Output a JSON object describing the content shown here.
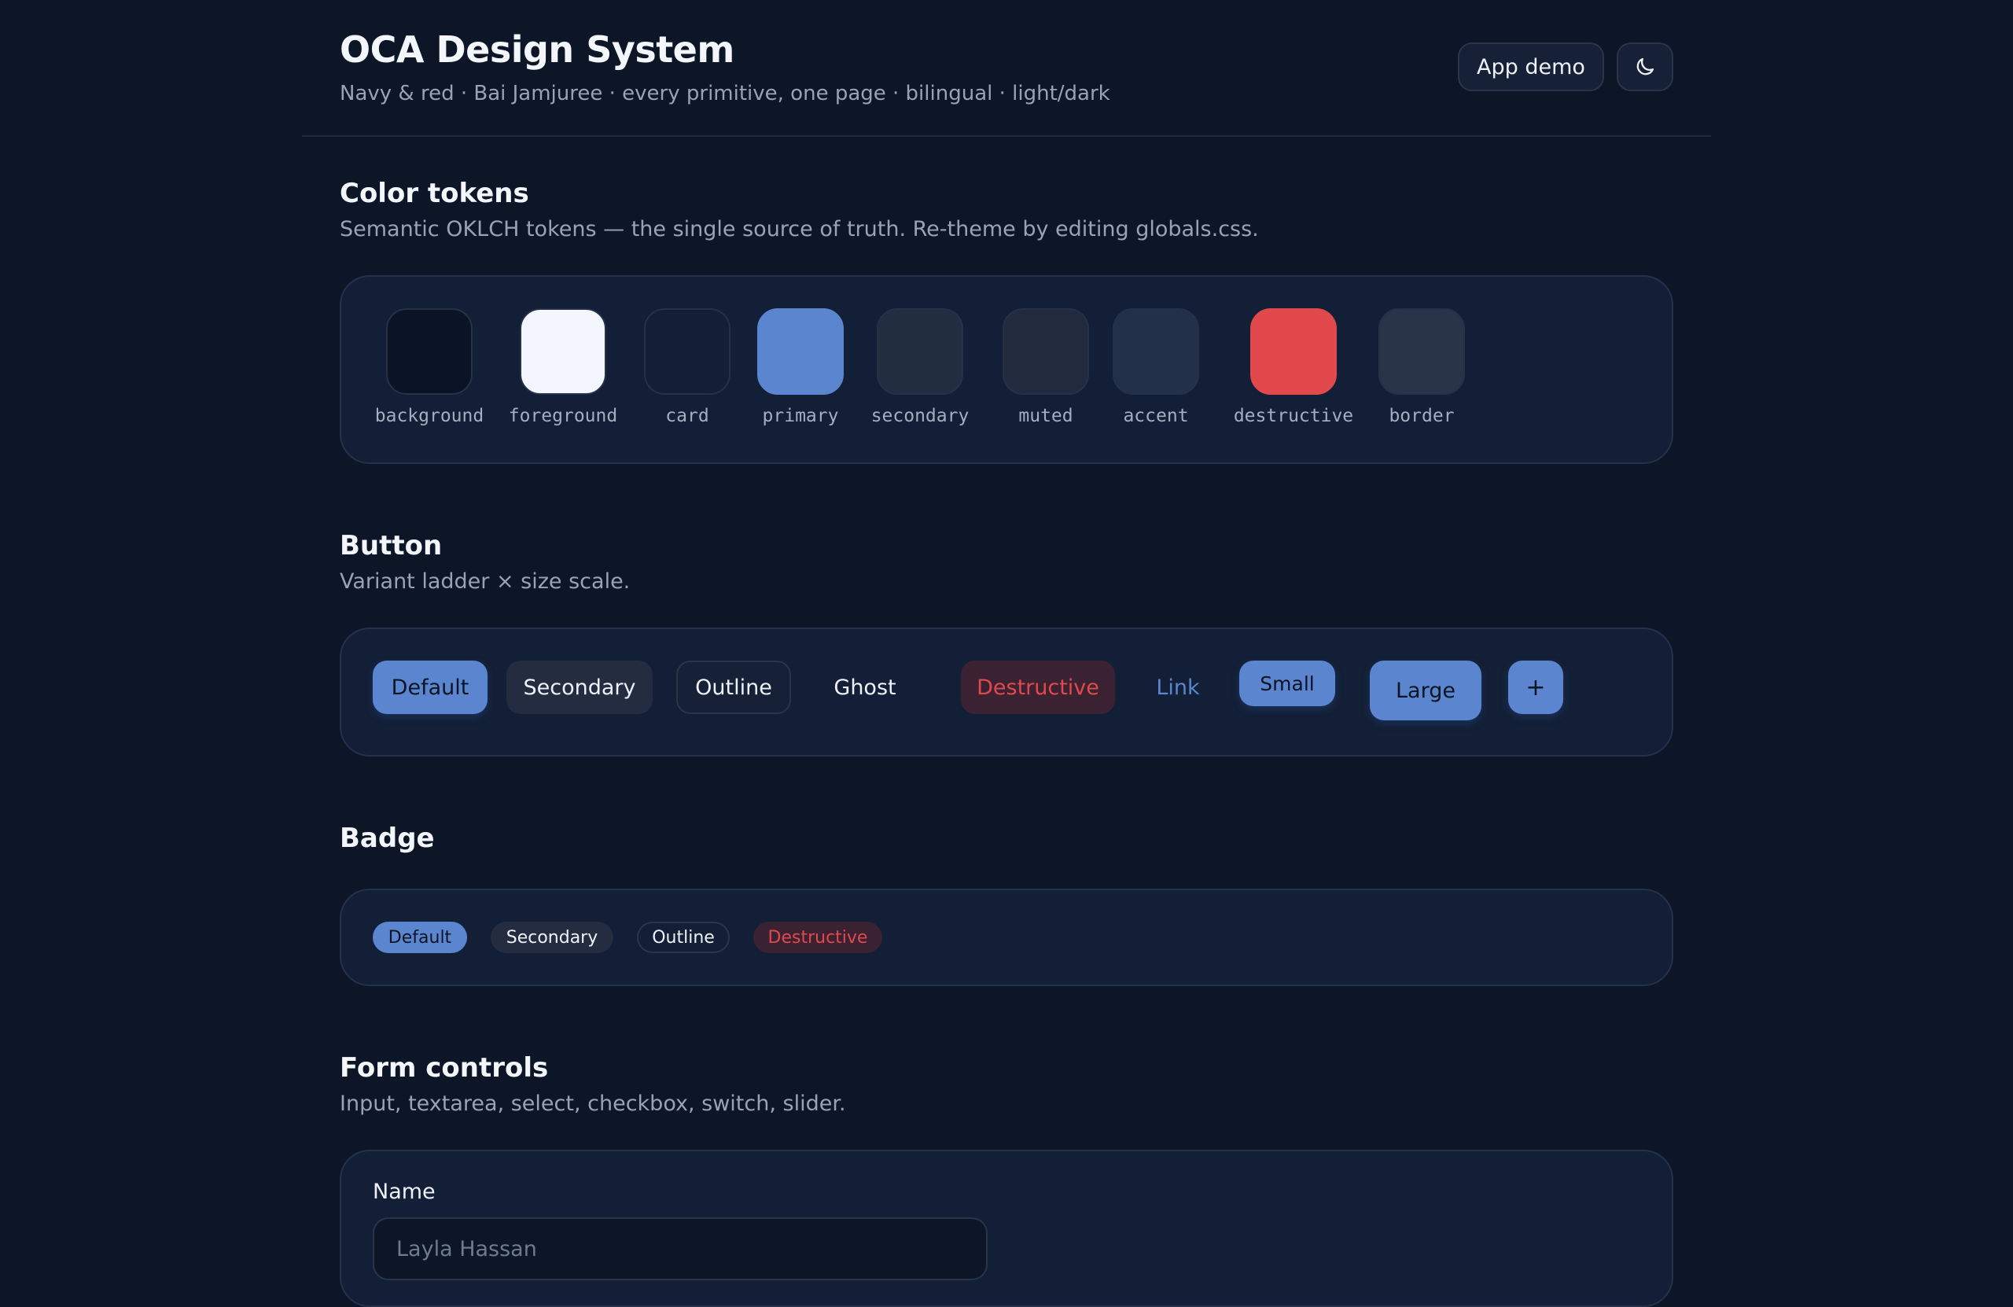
{
  "header": {
    "title": "OCA Design System",
    "subtitle": "Navy & red · Bai Jamjuree · every primitive, one page · bilingual · light/dark",
    "demo_button": "App demo",
    "theme_toggle_icon": "moon-icon"
  },
  "color_tokens": {
    "title": "Color tokens",
    "description": "Semantic OKLCH tokens — the single source of truth. Re-theme by editing globals.css.",
    "tokens": [
      {
        "name": "background",
        "color": "#0b1424"
      },
      {
        "name": "foreground",
        "color": "#f3f6fc"
      },
      {
        "name": "card",
        "color": "#131f36"
      },
      {
        "name": "primary",
        "color": "#5b86cf"
      },
      {
        "name": "secondary",
        "color": "#222d40"
      },
      {
        "name": "muted",
        "color": "#212b3d"
      },
      {
        "name": "accent",
        "color": "#23304a"
      },
      {
        "name": "destructive",
        "color": "#e2494c"
      },
      {
        "name": "border",
        "color": "#283447"
      }
    ]
  },
  "button": {
    "title": "Button",
    "description": "Variant ladder × size scale.",
    "labels": {
      "default": "Default",
      "secondary": "Secondary",
      "outline": "Outline",
      "ghost": "Ghost",
      "destructive": "Destructive",
      "link": "Link",
      "small": "Small",
      "large": "Large",
      "icon": "+"
    }
  },
  "badge": {
    "title": "Badge",
    "labels": {
      "default": "Default",
      "secondary": "Secondary",
      "outline": "Outline",
      "destructive": "Destructive"
    }
  },
  "form_controls": {
    "title": "Form controls",
    "description": "Input, textarea, select, checkbox, switch, slider.",
    "name_label": "Name",
    "name_placeholder": "Layla Hassan"
  }
}
